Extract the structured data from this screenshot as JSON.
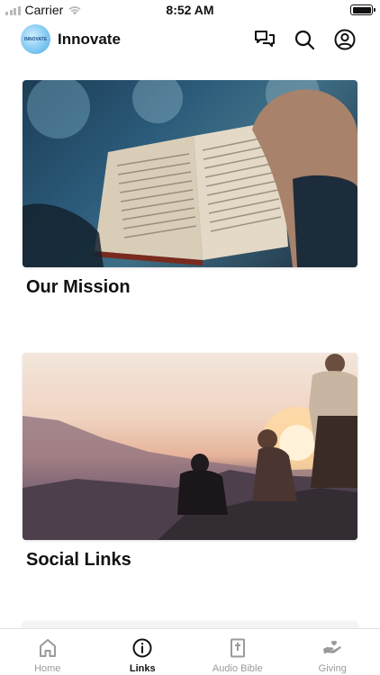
{
  "status_bar": {
    "carrier": "Carrier",
    "time": "8:52 AM",
    "battery_level": 1.0
  },
  "header": {
    "logo_text": "INNOVATE",
    "title": "Innovate",
    "icons": [
      "chat-icon",
      "search-icon",
      "profile-icon"
    ]
  },
  "cards": [
    {
      "title": "Our Mission",
      "image": "bible-reading-photo"
    },
    {
      "title": "Social Links",
      "image": "sunset-mountain-photo"
    }
  ],
  "tab_bar": {
    "active_index": 1,
    "active_color": "#111111",
    "inactive_color": "#9a9a9a",
    "tabs": [
      {
        "label": "Home",
        "icon": "home-icon"
      },
      {
        "label": "Links",
        "icon": "info-icon"
      },
      {
        "label": "Audio Bible",
        "icon": "bible-icon"
      },
      {
        "label": "Giving",
        "icon": "giving-hand-icon"
      }
    ]
  }
}
